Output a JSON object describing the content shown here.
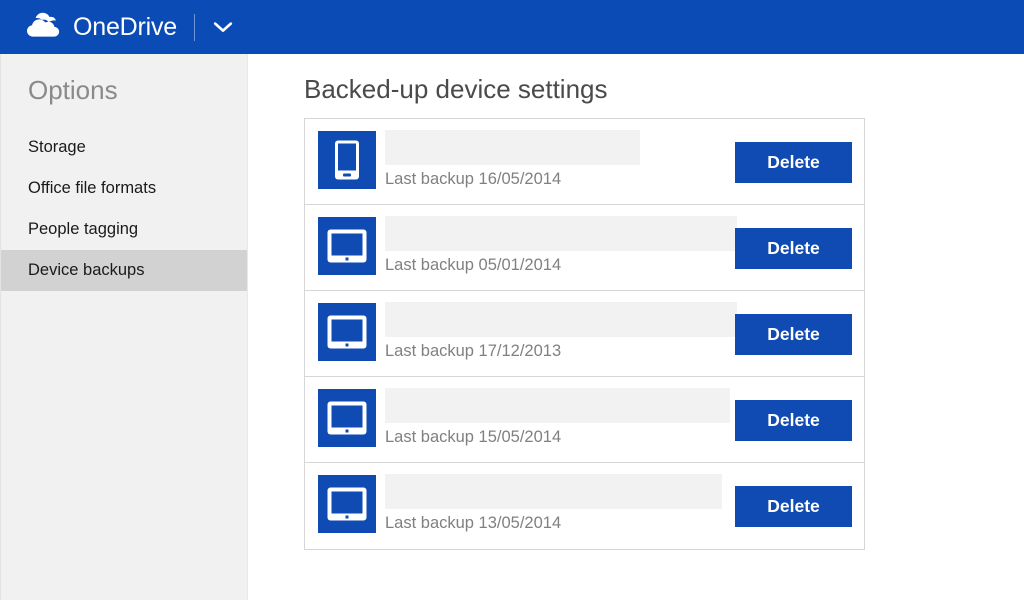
{
  "appbar": {
    "brand": "OneDrive",
    "logo_icon": "onedrive-cloud-icon",
    "chevron_icon": "chevron-down-icon",
    "background_color": "#0b4bb5"
  },
  "sidebar": {
    "title": "Options",
    "items": [
      {
        "label": "Storage",
        "selected": false
      },
      {
        "label": "Office file formats",
        "selected": false
      },
      {
        "label": "People tagging",
        "selected": false
      },
      {
        "label": "Device backups",
        "selected": true
      }
    ],
    "background_color": "#f1f1f1",
    "selected_color": "#d2d2d2"
  },
  "main": {
    "title": "Backed-up device settings",
    "accent_color": "#0f4bb2",
    "devices": [
      {
        "icon": "phone-icon",
        "name_redacted": true,
        "redaction_width": 255,
        "backup_label": "Last backup 16/05/2014",
        "delete_label": "Delete"
      },
      {
        "icon": "tablet-icon",
        "name_redacted": true,
        "redaction_width": 352,
        "backup_label": "Last backup 05/01/2014",
        "delete_label": "Delete"
      },
      {
        "icon": "tablet-icon",
        "name_redacted": true,
        "redaction_width": 352,
        "backup_label": "Last backup 17/12/2013",
        "delete_label": "Delete"
      },
      {
        "icon": "tablet-icon",
        "name_redacted": true,
        "redaction_width": 345,
        "backup_label": "Last backup 15/05/2014",
        "delete_label": "Delete"
      },
      {
        "icon": "tablet-icon",
        "name_redacted": true,
        "redaction_width": 337,
        "backup_label": "Last backup 13/05/2014",
        "delete_label": "Delete"
      }
    ]
  }
}
